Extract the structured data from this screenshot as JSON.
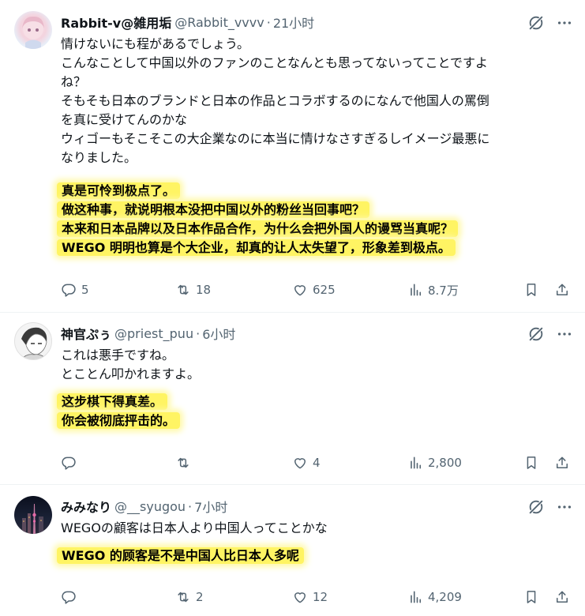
{
  "tweets": [
    {
      "name": "Rabbit-v@雑用垢",
      "handle": "@Rabbit_vvvv",
      "dot": "·",
      "time": "21小时",
      "text": [
        "情けないにも程があるでしょう。",
        "こんなことして中国以外のファンのことなんとも思ってないってことですよ",
        "ね？",
        "そもそも日本のブランドと日本の作品とコラボするのになんで他国人の罵倒",
        "を真に受けてんのかな",
        "ウィゴーもそこそこの大企業なのに本当に情けなさすぎるしイメージ最悪に",
        "なりました。"
      ],
      "translation": [
        "真是可怜到极点了。",
        "做这种事，就说明根本没把中国以外的粉丝当回事吧？",
        "本来和日本品牌以及日本作品合作，为什么会把外国人的谩骂当真呢？",
        "WEGO 明明也算是个大企业，却真的让人太失望了，形象差到极点。"
      ],
      "replies": "5",
      "reposts": "18",
      "likes": "625",
      "views": "8.7万"
    },
    {
      "name": "神官ぷぅ",
      "handle": "@priest_puu",
      "dot": "·",
      "time": "6小时",
      "text": [
        "これは悪手ですね。",
        "とことん叩かれますよ。"
      ],
      "translation": [
        "这步棋下得真差。",
        "你会被彻底抨击的。"
      ],
      "replies": "",
      "reposts": "",
      "likes": "4",
      "views": "2,800"
    },
    {
      "name": "みみなり",
      "handle": "@__syugou",
      "dot": "·",
      "time": "7小时",
      "text": [
        "WEGOの顧客は日本人より中国人ってことかな"
      ],
      "translation": [
        "WEGO 的顾客是不是中国人比日本人多呢"
      ],
      "replies": "",
      "reposts": "2",
      "likes": "12",
      "views": "4,209"
    }
  ],
  "colors": {
    "text": "#0f1419",
    "secondary": "#536471",
    "highlight": "#fff463",
    "divider": "#eff3f4"
  },
  "icons": [
    "grok-icon",
    "more-icon",
    "reply-icon",
    "repost-icon",
    "like-icon",
    "views-icon",
    "bookmark-icon",
    "share-icon"
  ]
}
